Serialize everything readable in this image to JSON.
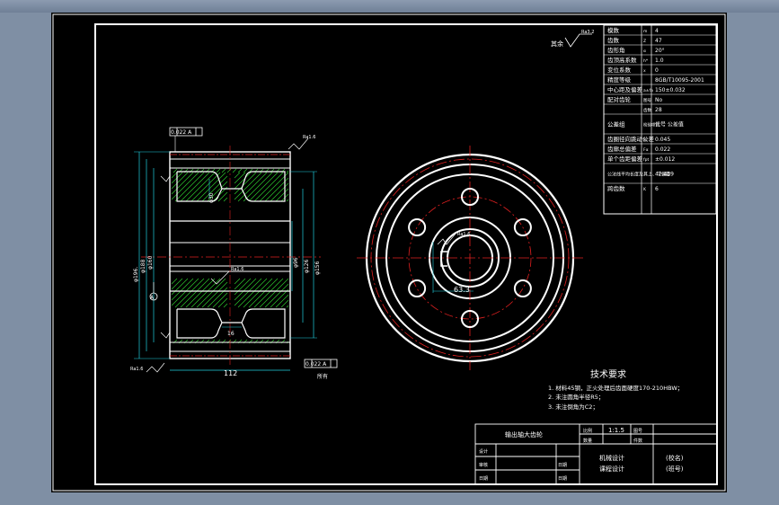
{
  "param_table": {
    "rows": [
      {
        "name": "模数",
        "sym": "m",
        "val": "4"
      },
      {
        "name": "齿数",
        "sym": "Z",
        "val": "47"
      },
      {
        "name": "齿形角",
        "sym": "α",
        "val": "20°"
      },
      {
        "name": "齿顶高系数",
        "sym": "h*",
        "val": "1.0"
      },
      {
        "name": "变位系数",
        "sym": "x",
        "val": "0"
      },
      {
        "name": "精度等级",
        "sym": "",
        "val": "8GB/T10095-2001"
      },
      {
        "name": "中心距及偏差",
        "sym": "a±fa",
        "val": "150±0.032"
      },
      {
        "name": "配对齿轮",
        "sym": "图号",
        "val": "No"
      },
      {
        "name": "",
        "sym": "齿数",
        "val": "28"
      },
      {
        "name": "公差组",
        "sym": "检验项目",
        "val": "代号 公差值"
      },
      {
        "name": "齿圈径向跳动公差",
        "sym": "Fr",
        "val": "0.045"
      },
      {
        "name": "齿廓总偏差",
        "sym": "Fα",
        "val": "0.022"
      },
      {
        "name": "单个齿距偏差",
        "sym": "fpt",
        "val": "±0.012"
      },
      {
        "name": "公法线平均长度及其上、下偏差",
        "sym": "",
        "val": "42.439"
      },
      {
        "name": "跨齿数",
        "sym": "K",
        "val": "6"
      }
    ],
    "tol_small": "-0.0.40 -0.0.70"
  },
  "annotations": {
    "other_roughness": "其余",
    "rough_top": "Ra3.2",
    "rough_small": "Ra1.6",
    "dim_width": "112",
    "dim_d1": "φ196.",
    "dim_d2": "φ188",
    "dim_d3": "φ160",
    "dim_d4": "φ96",
    "dim_d5": "φ126",
    "dim_d6": "φ156",
    "dim_web": "16",
    "dim_bore": "63.3",
    "gtol_top": "0.022 A",
    "gtol_bottom": "0.022 A",
    "datum": "A",
    "bottom_note": "所有",
    "hole_dim": "φ30"
  },
  "tech": {
    "title": "技术要求",
    "items": [
      "1. 材料45钢，正火处理后齿面硬度170-210HBW；",
      "2. 未注圆角半径R5；",
      "3. 未注倒角为C2；"
    ]
  },
  "title_block": {
    "name": "输出轴大齿轮",
    "scale_label": "比例",
    "scale": "1:1.5",
    "drawing_no_label": "图号",
    "qty_label": "件数",
    "material_label": "数量",
    "drawer_label": "设计",
    "checker_label": "审核",
    "date_label": "日期",
    "course1": "机械设计",
    "course2": "课程设计",
    "school": "(校名)",
    "class": "(班号)"
  }
}
